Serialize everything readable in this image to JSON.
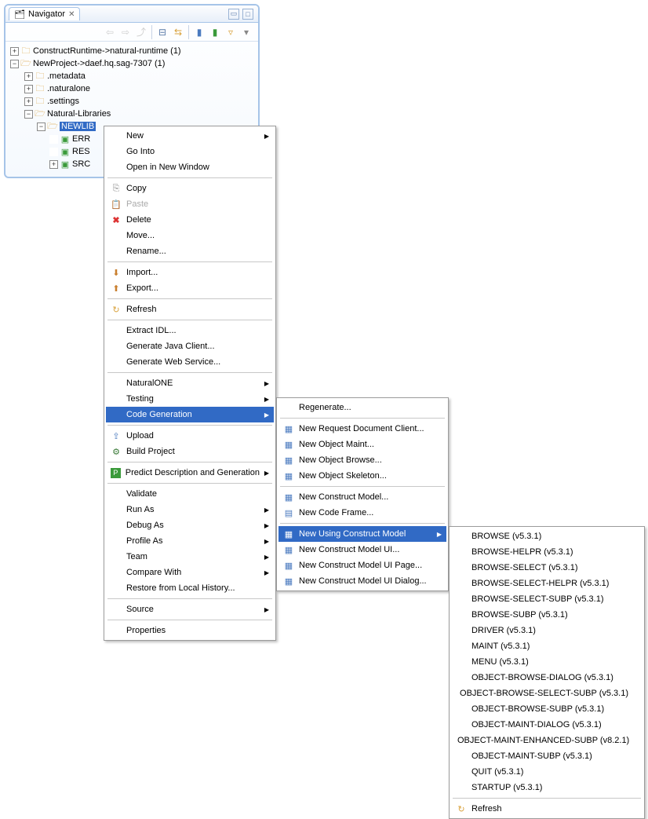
{
  "panel": {
    "title": "Navigator"
  },
  "tree": {
    "n0": "ConstructRuntime->natural-runtime (1)",
    "n1": "NewProject->daef.hq.sag-7307 (1)",
    "n2": ".metadata",
    "n3": ".naturalone",
    "n4": ".settings",
    "n5": "Natural-Libraries",
    "n6": "NEWLIB",
    "n7": "ERR",
    "n8": "RES",
    "n9": "SRC"
  },
  "menu1": {
    "new": "New",
    "gointo": "Go Into",
    "opennew": "Open in New Window",
    "copy": "Copy",
    "paste": "Paste",
    "delete": "Delete",
    "move": "Move...",
    "rename": "Rename...",
    "import": "Import...",
    "export": "Export...",
    "refresh": "Refresh",
    "extractidl": "Extract IDL...",
    "genjava": "Generate Java Client...",
    "genweb": "Generate Web Service...",
    "naturalone": "NaturalONE",
    "testing": "Testing",
    "codegen": "Code Generation",
    "upload": "Upload",
    "build": "Build Project",
    "predict": "Predict Description and Generation",
    "validate": "Validate",
    "runas": "Run As",
    "debugas": "Debug As",
    "profileas": "Profile As",
    "team": "Team",
    "compare": "Compare With",
    "restore": "Restore from Local History...",
    "source": "Source",
    "properties": "Properties"
  },
  "menu2": {
    "regenerate": "Regenerate...",
    "newreq": "New Request Document Client...",
    "newobjmaint": "New Object Maint...",
    "newobjbrowse": "New Object Browse...",
    "newobjskel": "New Object Skeleton...",
    "newconmodel": "New Construct Model...",
    "newcodeframe": "New Code Frame...",
    "newusing": "New Using Construct Model",
    "newconui": "New Construct Model UI...",
    "newconuipage": "New Construct Model UI Page...",
    "newconuidialog": "New Construct Model UI Dialog..."
  },
  "menu3": {
    "i0": "BROWSE (v5.3.1)",
    "i1": "BROWSE-HELPR (v5.3.1)",
    "i2": "BROWSE-SELECT (v5.3.1)",
    "i3": "BROWSE-SELECT-HELPR (v5.3.1)",
    "i4": "BROWSE-SELECT-SUBP (v5.3.1)",
    "i5": "BROWSE-SUBP (v5.3.1)",
    "i6": "DRIVER (v5.3.1)",
    "i7": "MAINT (v5.3.1)",
    "i8": "MENU (v5.3.1)",
    "i9": "OBJECT-BROWSE-DIALOG (v5.3.1)",
    "i10": "OBJECT-BROWSE-SELECT-SUBP (v5.3.1)",
    "i11": "OBJECT-BROWSE-SUBP (v5.3.1)",
    "i12": "OBJECT-MAINT-DIALOG (v5.3.1)",
    "i13": "OBJECT-MAINT-ENHANCED-SUBP (v8.2.1)",
    "i14": "OBJECT-MAINT-SUBP (v5.3.1)",
    "i15": "QUIT (v5.3.1)",
    "i16": "STARTUP (v5.3.1)",
    "refresh": "Refresh"
  }
}
